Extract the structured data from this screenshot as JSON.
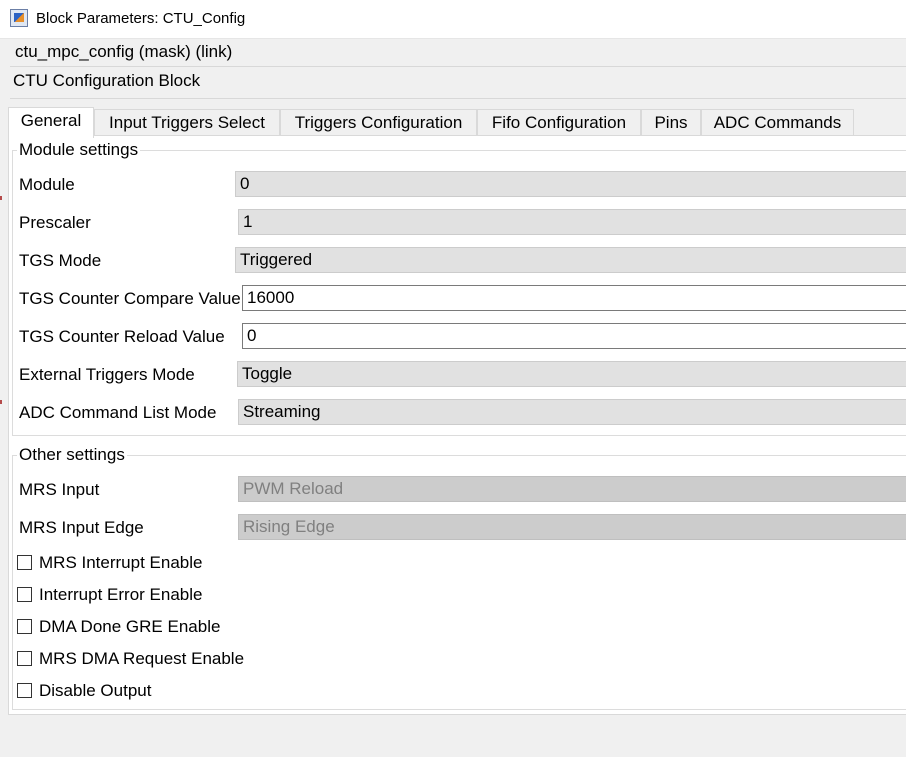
{
  "window": {
    "title": "Block Parameters: CTU_Config"
  },
  "block": {
    "subtitle": "ctu_mpc_config (mask) (link)",
    "description": "CTU Configuration Block"
  },
  "tabs": [
    {
      "label": "General",
      "active": true
    },
    {
      "label": "Input Triggers Select",
      "active": false
    },
    {
      "label": "Triggers Configuration",
      "active": false
    },
    {
      "label": "Fifo Configuration",
      "active": false
    },
    {
      "label": "Pins",
      "active": false
    },
    {
      "label": "ADC Commands",
      "active": false
    }
  ],
  "module_settings": {
    "title": "Module settings",
    "module": {
      "label": "Module",
      "value": "0"
    },
    "prescaler": {
      "label": "Prescaler",
      "value": "1"
    },
    "tgs_mode": {
      "label": "TGS Mode",
      "value": "Triggered"
    },
    "tgs_compare": {
      "label": "TGS Counter Compare Value",
      "value": "16000"
    },
    "tgs_reload": {
      "label": "TGS Counter Reload Value",
      "value": "0"
    },
    "ext_triggers_mode": {
      "label": "External Triggers Mode",
      "value": "Toggle"
    },
    "adc_list_mode": {
      "label": "ADC Command List Mode",
      "value": "Streaming"
    }
  },
  "other_settings": {
    "title": "Other settings",
    "mrs_input": {
      "label": "MRS Input",
      "value": "PWM Reload"
    },
    "mrs_input_edge": {
      "label": "MRS Input Edge",
      "value": "Rising Edge"
    },
    "checkboxes": [
      {
        "label": "MRS Interrupt Enable",
        "checked": false
      },
      {
        "label": "Interrupt Error Enable",
        "checked": false
      },
      {
        "label": "DMA Done GRE Enable",
        "checked": false
      },
      {
        "label": "MRS DMA Request Enable",
        "checked": false
      },
      {
        "label": "Disable Output",
        "checked": false
      }
    ]
  }
}
